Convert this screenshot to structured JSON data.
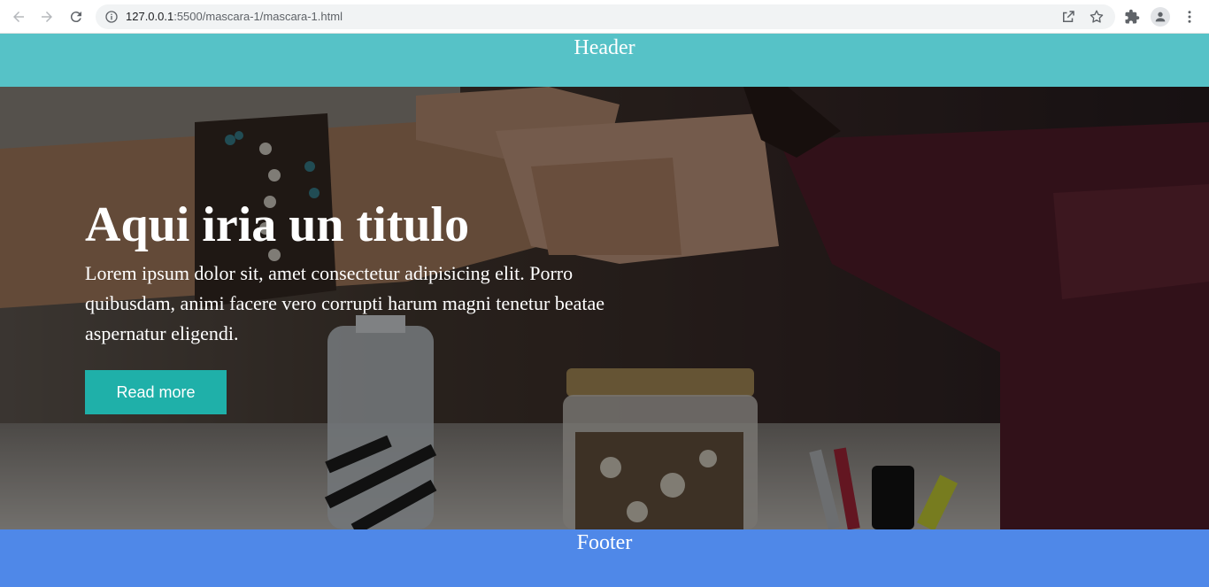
{
  "browser": {
    "url_host": "127.0.0.1",
    "url_rest": ":5500/mascara-1/mascara-1.html",
    "icons": [
      "back-arrow-icon",
      "forward-arrow-icon",
      "reload-icon",
      "info-icon",
      "share-icon",
      "star-icon",
      "extensions-icon",
      "profile-icon",
      "menu-dots-icon"
    ]
  },
  "header": {
    "title": "Header"
  },
  "hero": {
    "title": "Aqui iria un titulo",
    "text": "Lorem ipsum dolor sit, amet consectetur adipisicing elit. Porro quibusdam, animi facere vero corrupti harum magni tenetur beatae aspernatur eligendi.",
    "button_label": "Read more",
    "image_description": "fist bump photo background"
  },
  "footer": {
    "title": "Footer"
  },
  "colors": {
    "header_bg": "#56c2c7",
    "footer_bg": "#4f88e8",
    "button_bg": "#1fb0a9",
    "hero_text": "#ffffff"
  }
}
